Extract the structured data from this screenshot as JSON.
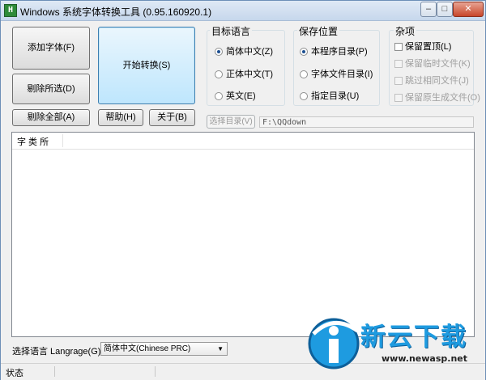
{
  "titlebar": {
    "title": "Windows 系统字体转换工具 (0.95.160920.1)",
    "app_icon": "H",
    "minimize": "–",
    "maximize": "□",
    "close": "✕"
  },
  "buttons": {
    "add_font": "添加字体(F)",
    "remove_selected": "剔除所选(D)",
    "remove_all": "剔除全部(A)",
    "start_convert": "开始转换(S)",
    "help": "帮助(H)",
    "about": "关于(B)",
    "choose_dir": "选择目录(V)"
  },
  "target_language": {
    "title": "目标语言",
    "options": [
      "简体中文(Z)",
      "正体中文(T)",
      "英文(E)"
    ],
    "selected_index": 0
  },
  "save_location": {
    "title": "保存位置",
    "options": [
      "本程序目录(P)",
      "字体文件目录(I)",
      "指定目录(U)"
    ],
    "selected_index": 0
  },
  "misc": {
    "title": "杂项",
    "options": [
      "保留置顶(L)",
      "保留临时文件(K)",
      "跳过相同文件(J)",
      "保留原生成文件(O)"
    ],
    "enabled": [
      true,
      false,
      false,
      false
    ]
  },
  "path_value": "F:\\QQdown",
  "list": {
    "header": "字 类 所"
  },
  "language_select": {
    "label": "选择语言 Langrage(G):",
    "value": "简体中文(Chinese PRC)",
    "arrow": "▼"
  },
  "status": {
    "text": "状态"
  },
  "watermark": {
    "title": "新云下载",
    "url": "www.newasp.net"
  },
  "colors": {
    "accent": "#3c7fb1",
    "watermark_blue": "#1e9be0",
    "titlebar": "#c6d7ec"
  }
}
